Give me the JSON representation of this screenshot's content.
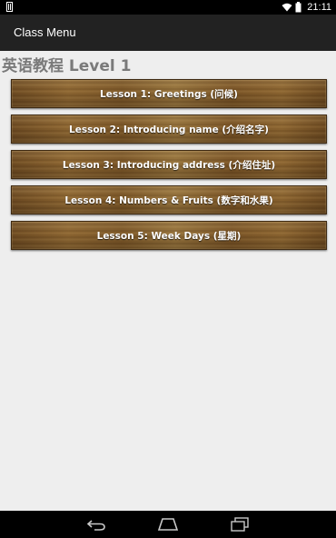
{
  "status_bar": {
    "time": "21:11",
    "icons": [
      "sim-icon",
      "wifi-icon",
      "battery-icon"
    ]
  },
  "app_bar": {
    "title": "Class Menu"
  },
  "main": {
    "heading": "英语教程 Level 1",
    "lessons": [
      {
        "label": "Lesson 1: Greetings (问候)"
      },
      {
        "label": "Lesson 2: Introducing name (介绍名字)"
      },
      {
        "label": "Lesson 3: Introducing address (介绍住址)"
      },
      {
        "label": "Lesson 4: Numbers & Fruits (数字和水果)"
      },
      {
        "label": "Lesson 5: Week Days (星期)"
      }
    ]
  },
  "nav_bar": {
    "buttons": [
      "back-icon",
      "home-icon",
      "recents-icon"
    ]
  },
  "colors": {
    "status_bar_bg": "#000000",
    "action_bar_bg": "#222222",
    "page_bg": "#eeeeee",
    "heading_text": "#7a7a7a",
    "button_wood": "#8c6531"
  }
}
